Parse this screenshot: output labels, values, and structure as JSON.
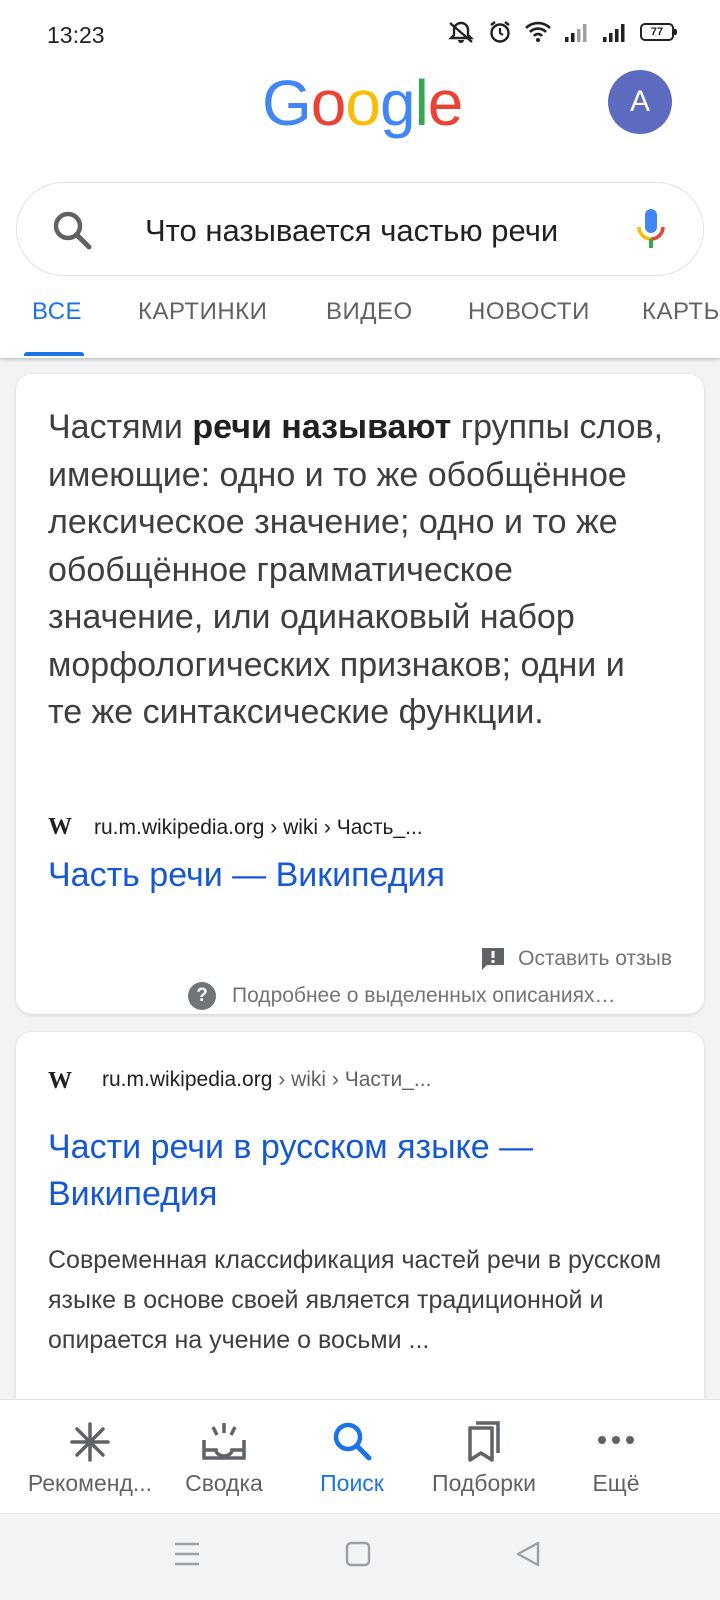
{
  "status_bar": {
    "time": "13:23",
    "battery": "77",
    "icons": [
      "mute-icon",
      "alarm-icon",
      "wifi-icon",
      "signal-icon",
      "signal-icon",
      "battery-icon"
    ]
  },
  "header": {
    "logo_letters": [
      {
        "ch": "G",
        "color": "#4285F4"
      },
      {
        "ch": "o",
        "color": "#EA4335"
      },
      {
        "ch": "o",
        "color": "#FBBC05"
      },
      {
        "ch": "g",
        "color": "#4285F4"
      },
      {
        "ch": "l",
        "color": "#34A853"
      },
      {
        "ch": "e",
        "color": "#EA4335"
      }
    ],
    "avatar_letter": "A",
    "avatar_color": "#5C6BC0"
  },
  "search": {
    "query": "Что называется частью речи"
  },
  "tabs": [
    {
      "label": "ВСЕ",
      "active": true
    },
    {
      "label": "КАРТИНКИ",
      "active": false
    },
    {
      "label": "ВИДЕО",
      "active": false
    },
    {
      "label": "НОВОСТИ",
      "active": false
    },
    {
      "label": "КАРТЫ",
      "active": false
    }
  ],
  "featured_snippet": {
    "text_before": "Частями ",
    "text_bold": "речи называют",
    "text_after": " группы слов, имеющие: одно и то же обобщённое лексическое значение; одно и то же обобщённое грамматическое значение, или одинаковый набор морфологических признаков; одни и те же синтаксические функции.",
    "site_logo": "W",
    "cite_domain": "ru.m.wikipedia.org",
    "cite_path": " › wiki › Часть_...",
    "link_title": "Часть речи — Википедия",
    "feedback_label": "Оставить отзыв",
    "about_label": "Подробнее о выделенных описаниях…"
  },
  "result": {
    "site_logo": "W",
    "cite_domain": "ru.m.wikipedia.org",
    "cite_path": " › wiki › Части_...",
    "link_title": "Части речи в русском языке — Википедия",
    "description": "Современная классификация частей речи в русском языке в основе своей является традиционной и опирается на учение о восьми ..."
  },
  "bottom_nav": [
    {
      "label": "Рекоменд...",
      "icon": "asterisk-icon",
      "active": false
    },
    {
      "label": "Сводка",
      "icon": "inbox-icon",
      "active": false
    },
    {
      "label": "Поиск",
      "icon": "search-icon",
      "active": true
    },
    {
      "label": "Подборки",
      "icon": "collections-icon",
      "active": false
    },
    {
      "label": "Ещё",
      "icon": "more-icon",
      "active": false
    }
  ],
  "colors": {
    "accent": "#1A73E8",
    "link": "#1558D6"
  }
}
